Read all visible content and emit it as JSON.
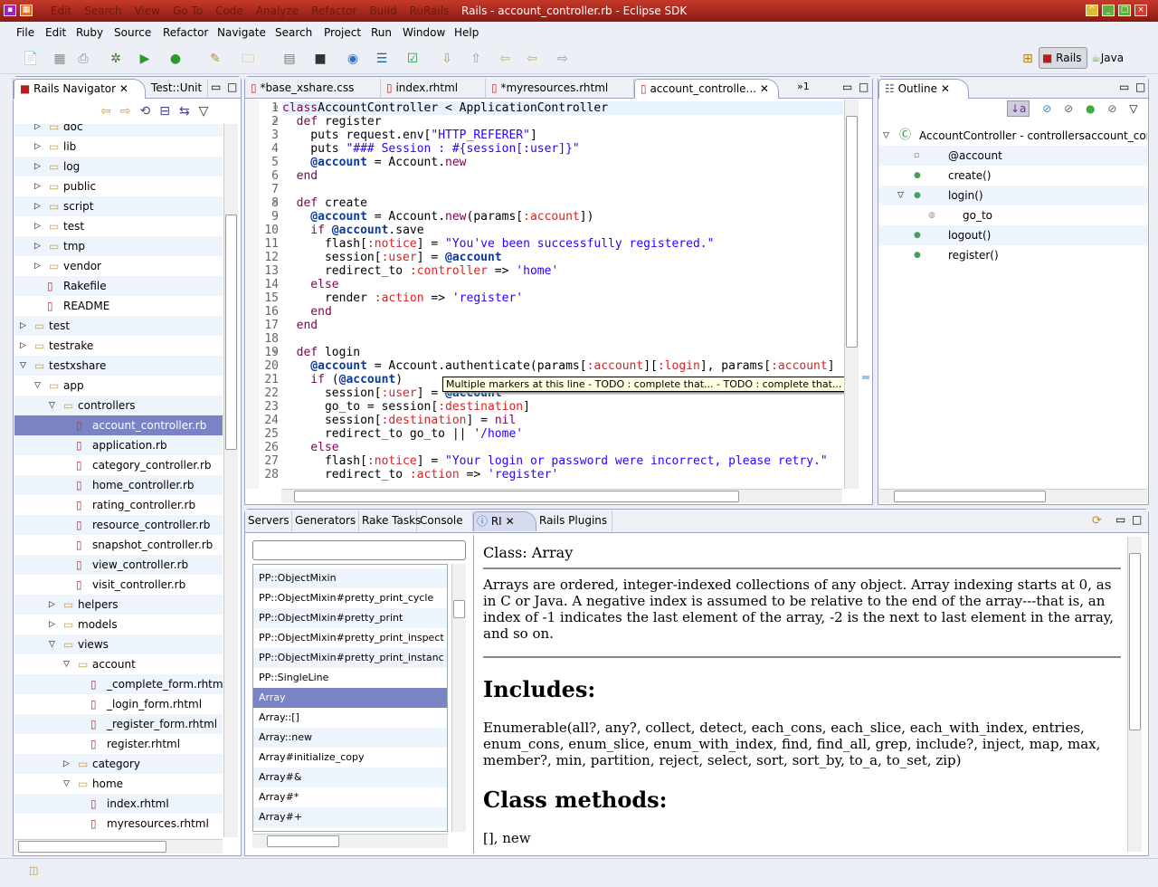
{
  "window": {
    "title": "Rails - account_controller.rb - Eclipse SDK",
    "bg_menu": [
      "Edit",
      "Search",
      "View",
      "Go To",
      "Code",
      "Analyze",
      "Refactor",
      "Build",
      "RuRails"
    ]
  },
  "menu": [
    "File",
    "Edit",
    "Ruby",
    "Source",
    "Refactor",
    "Navigate",
    "Search",
    "Project",
    "Run",
    "Window",
    "Help"
  ],
  "perspectives": [
    {
      "label": "Rails",
      "active": true
    },
    {
      "label": "Java",
      "active": false
    }
  ],
  "navigator": {
    "tabs": [
      "Rails Navigator",
      "Test::Unit"
    ],
    "tree": [
      {
        "l": "doc",
        "d": 1,
        "t": "folder",
        "e": false
      },
      {
        "l": "lib",
        "d": 1,
        "t": "folder",
        "e": false
      },
      {
        "l": "log",
        "d": 1,
        "t": "folder",
        "e": false
      },
      {
        "l": "public",
        "d": 1,
        "t": "folder",
        "e": false
      },
      {
        "l": "script",
        "d": 1,
        "t": "folder",
        "e": false
      },
      {
        "l": "test",
        "d": 1,
        "t": "folder",
        "e": false
      },
      {
        "l": "tmp",
        "d": 1,
        "t": "folder",
        "e": false
      },
      {
        "l": "vendor",
        "d": 1,
        "t": "folder",
        "e": false
      },
      {
        "l": "Rakefile",
        "d": 1,
        "t": "file"
      },
      {
        "l": "README",
        "d": 1,
        "t": "file"
      },
      {
        "l": "test",
        "d": 0,
        "t": "folder",
        "e": false
      },
      {
        "l": "testrake",
        "d": 0,
        "t": "folder",
        "e": false
      },
      {
        "l": "testxshare",
        "d": 0,
        "t": "project",
        "e": true
      },
      {
        "l": "app",
        "d": 1,
        "t": "folder",
        "e": true
      },
      {
        "l": "controllers",
        "d": 2,
        "t": "folder",
        "e": true
      },
      {
        "l": "account_controller.rb",
        "d": 3,
        "t": "file",
        "sel": true
      },
      {
        "l": "application.rb",
        "d": 3,
        "t": "file"
      },
      {
        "l": "category_controller.rb",
        "d": 3,
        "t": "file"
      },
      {
        "l": "home_controller.rb",
        "d": 3,
        "t": "file"
      },
      {
        "l": "rating_controller.rb",
        "d": 3,
        "t": "file"
      },
      {
        "l": "resource_controller.rb",
        "d": 3,
        "t": "file"
      },
      {
        "l": "snapshot_controller.rb",
        "d": 3,
        "t": "file"
      },
      {
        "l": "view_controller.rb",
        "d": 3,
        "t": "file"
      },
      {
        "l": "visit_controller.rb",
        "d": 3,
        "t": "file"
      },
      {
        "l": "helpers",
        "d": 2,
        "t": "folder",
        "e": false
      },
      {
        "l": "models",
        "d": 2,
        "t": "folder",
        "e": false
      },
      {
        "l": "views",
        "d": 2,
        "t": "folder",
        "e": true
      },
      {
        "l": "account",
        "d": 3,
        "t": "folder",
        "e": true
      },
      {
        "l": "_complete_form.rhtml",
        "d": 4,
        "t": "file"
      },
      {
        "l": "_login_form.rhtml",
        "d": 4,
        "t": "file"
      },
      {
        "l": "_register_form.rhtml",
        "d": 4,
        "t": "file"
      },
      {
        "l": "register.rhtml",
        "d": 4,
        "t": "file"
      },
      {
        "l": "category",
        "d": 3,
        "t": "folder",
        "e": false
      },
      {
        "l": "home",
        "d": 3,
        "t": "folder",
        "e": true
      },
      {
        "l": "index.rhtml",
        "d": 4,
        "t": "file"
      },
      {
        "l": "myresources.rhtml",
        "d": 4,
        "t": "file"
      }
    ]
  },
  "editor": {
    "tabs": [
      "*base_xshare.css",
      "index.rhtml",
      "*myresources.rhtml",
      "account_controlle..."
    ],
    "overflow": "»1",
    "lines": [
      [
        [
          "kw",
          "class"
        ],
        [
          "",
          "AccountController < ApplicationController"
        ]
      ],
      [
        [
          "",
          "  "
        ],
        [
          "kw",
          "def"
        ],
        [
          "",
          " register"
        ]
      ],
      [
        [
          "",
          "    puts request.env["
        ],
        [
          "st",
          "\"HTTP_REFERER\""
        ],
        [
          "",
          "]"
        ]
      ],
      [
        [
          "",
          "    puts "
        ],
        [
          "st",
          "\"### Session : #{session[:user]}\""
        ]
      ],
      [
        [
          "iv",
          "    @account"
        ],
        [
          "",
          " = Account."
        ],
        [
          "kw",
          "new"
        ]
      ],
      [
        [
          "kw",
          "  end"
        ]
      ],
      [],
      [
        [
          "kw",
          "  def"
        ],
        [
          "",
          " create"
        ]
      ],
      [
        [
          "iv",
          "    @account"
        ],
        [
          "",
          " = Account."
        ],
        [
          "kw",
          "new"
        ],
        [
          "",
          "(params["
        ],
        [
          "sy",
          ":account"
        ],
        [
          "",
          "])"
        ]
      ],
      [
        [
          "kw",
          "    if"
        ],
        [
          "iv",
          " @account"
        ],
        [
          "",
          ".save"
        ]
      ],
      [
        [
          "",
          "      flash["
        ],
        [
          "sy",
          ":notice"
        ],
        [
          "",
          "] = "
        ],
        [
          "st",
          "\"You've been successfully registered.\""
        ]
      ],
      [
        [
          "",
          "      session["
        ],
        [
          "sy",
          ":user"
        ],
        [
          "",
          "] = "
        ],
        [
          "iv",
          "@account"
        ]
      ],
      [
        [
          "",
          "      redirect_to "
        ],
        [
          "sy",
          ":controller"
        ],
        [
          "",
          " => "
        ],
        [
          "st",
          "'home'"
        ]
      ],
      [
        [
          "kw",
          "    else"
        ]
      ],
      [
        [
          "",
          "      render "
        ],
        [
          "sy",
          ":action"
        ],
        [
          "",
          " => "
        ],
        [
          "st",
          "'register'"
        ]
      ],
      [
        [
          "kw",
          "    end"
        ]
      ],
      [
        [
          "kw",
          "  end"
        ]
      ],
      [],
      [
        [
          "kw",
          "  def"
        ],
        [
          "",
          " login"
        ]
      ],
      [
        [
          "iv",
          "    @account"
        ],
        [
          "",
          " = Account.authenticate(params["
        ],
        [
          "sy",
          ":account"
        ],
        [
          "",
          "]["
        ],
        [
          "sy",
          ":login"
        ],
        [
          "",
          "], params["
        ],
        [
          "sy",
          ":account"
        ],
        [
          "",
          "]"
        ]
      ],
      [
        [
          "kw",
          "    if"
        ],
        [
          "",
          " ("
        ],
        [
          "iv",
          "@account"
        ],
        [
          "",
          ")"
        ]
      ],
      [
        [
          "",
          "      session["
        ],
        [
          "sy",
          ":user"
        ],
        [
          "",
          "] = "
        ],
        [
          "iv",
          "@account"
        ]
      ],
      [
        [
          "",
          "      go_to = session["
        ],
        [
          "sy",
          ":destination"
        ],
        [
          "",
          "]"
        ]
      ],
      [
        [
          "",
          "      session["
        ],
        [
          "sy",
          ":destination"
        ],
        [
          "",
          "] = "
        ],
        [
          "kw",
          "nil"
        ]
      ],
      [
        [
          "",
          "      redirect_to go_to || "
        ],
        [
          "st",
          "'/home'"
        ]
      ],
      [
        [
          "kw",
          "    else"
        ]
      ],
      [
        [
          "",
          "      flash["
        ],
        [
          "sy",
          ":notice"
        ],
        [
          "",
          "] = "
        ],
        [
          "st",
          "\"Your login or password were incorrect, please retry.\""
        ]
      ],
      [
        [
          "",
          "      redirect_to "
        ],
        [
          "sy",
          ":action"
        ],
        [
          "",
          " => "
        ],
        [
          "st",
          "'register'"
        ]
      ]
    ],
    "folds": [
      1,
      2,
      8,
      19
    ],
    "tooltip": "Multiple markers at this line - TODO : complete that... - TODO : complete that..."
  },
  "outline": {
    "tab": "Outline",
    "items": [
      {
        "l": "AccountController - controllersaccount_contr",
        "d": 0,
        "icon": "class-icon"
      },
      {
        "l": "@account",
        "d": 1,
        "icon": "field-icon"
      },
      {
        "l": "create()",
        "d": 1,
        "icon": "method-icon"
      },
      {
        "l": "login()",
        "d": 1,
        "icon": "method-icon",
        "e": true
      },
      {
        "l": "go_to",
        "d": 2,
        "icon": "local-icon"
      },
      {
        "l": "logout()",
        "d": 1,
        "icon": "method-icon"
      },
      {
        "l": "register()",
        "d": 1,
        "icon": "method-icon"
      }
    ]
  },
  "bottom": {
    "tabs": [
      "Servers",
      "Generators",
      "Rake Tasks",
      "Console",
      "RI",
      "Rails Plugins"
    ],
    "active": "RI",
    "search_value": "",
    "list": [
      "PP::ObjectMixin",
      "PP::ObjectMixin#pretty_print_cycle",
      "PP::ObjectMixin#pretty_print",
      "PP::ObjectMixin#pretty_print_inspect",
      "PP::ObjectMixin#pretty_print_instanc",
      "PP::SingleLine",
      "Array",
      "Array::[]",
      "Array::new",
      "Array#initialize_copy",
      "Array#&",
      "Array#*",
      "Array#+"
    ],
    "selected": "Array",
    "doc": {
      "class_line": "Class: Array",
      "description": "Arrays are ordered, integer-indexed collections of any object. Array indexing starts at 0, as in C or Java. A negative index is assumed to be relative to the end of the array---that is, an index of -1 indicates the last element of the array, -2 is the next to last element in the array, and so on.",
      "includes_heading": "Includes:",
      "includes": "Enumerable(all?, any?, collect, detect, each_cons, each_slice, each_with_index, entries, enum_cons, enum_slice, enum_with_index, find, find_all, grep, include?, inject, map, max, member?, min, partition, reject, select, sort, sort_by, to_a, to_set, zip)",
      "class_methods_heading": "Class methods:",
      "class_methods": "[], new"
    }
  }
}
